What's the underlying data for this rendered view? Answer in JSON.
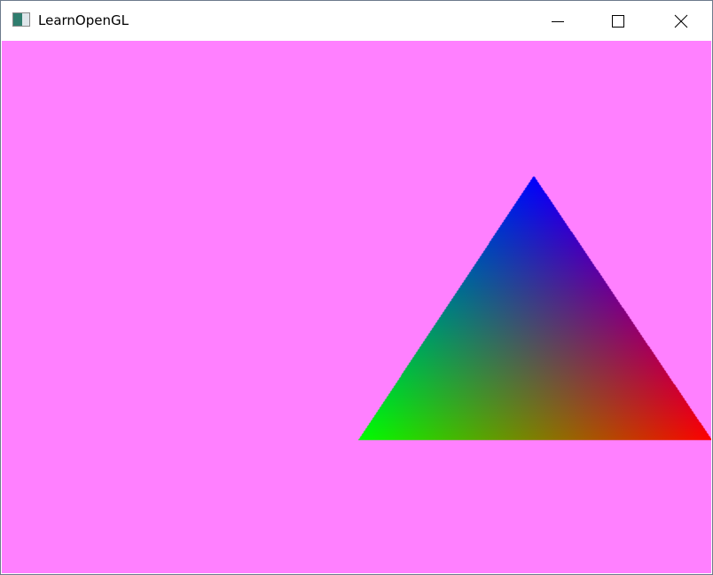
{
  "window": {
    "title": "LearnOpenGL"
  },
  "viewport": {
    "clear_color": "#ff80ff",
    "triangle": {
      "vertex_colors": {
        "top": "#0000ff",
        "bottom_left": "#00ff00",
        "bottom_right": "#ff0000"
      }
    }
  }
}
